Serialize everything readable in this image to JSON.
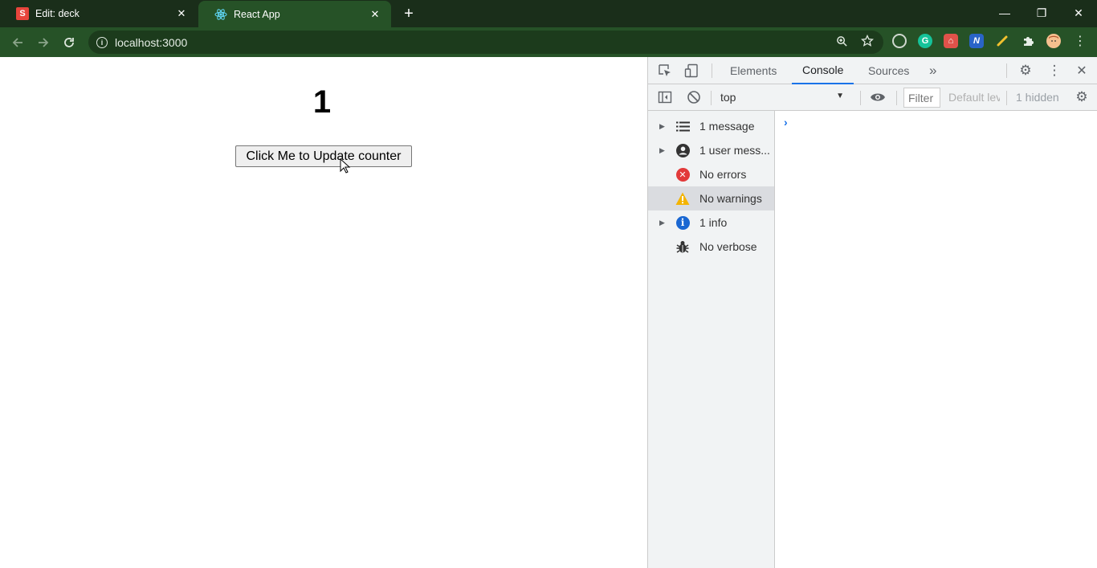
{
  "browser": {
    "tabs": [
      {
        "title": "Edit: deck",
        "favicon": "S",
        "close": "✕"
      },
      {
        "title": "React App",
        "favicon": "react-icon",
        "close": "✕"
      }
    ],
    "new_tab": "+",
    "window_controls": {
      "minimize": "—",
      "restore": "❐",
      "close": "✕"
    },
    "url": "localhost:3000",
    "info_glyph": "i"
  },
  "app": {
    "counter": "1",
    "button_label": "Click Me to Update counter"
  },
  "devtools": {
    "tabs": [
      "Elements",
      "Console",
      "Sources"
    ],
    "selected_tab": "Console",
    "more_tabs": "»",
    "context": "top",
    "filter_placeholder": "Filter",
    "levels": "Default levels",
    "hidden": "1 hidden",
    "sidebar": [
      {
        "label": "1 message",
        "icon": "list-icon",
        "expandable": true
      },
      {
        "label": "1 user mess...",
        "icon": "user-icon",
        "expandable": true
      },
      {
        "label": "No errors",
        "icon": "error-icon",
        "expandable": false
      },
      {
        "label": "No warnings",
        "icon": "warning-icon",
        "expandable": false,
        "highlighted": true
      },
      {
        "label": "1 info",
        "icon": "info-icon",
        "expandable": true
      },
      {
        "label": "No verbose",
        "icon": "bug-icon",
        "expandable": false
      }
    ],
    "prompt": "›"
  },
  "colors": {
    "tabstrip": "#1a2e1a",
    "toolbar": "#265227",
    "accent": "#1a73e8",
    "error": "#e23a3a",
    "warning": "#f4b400",
    "info": "#1a67d2"
  }
}
